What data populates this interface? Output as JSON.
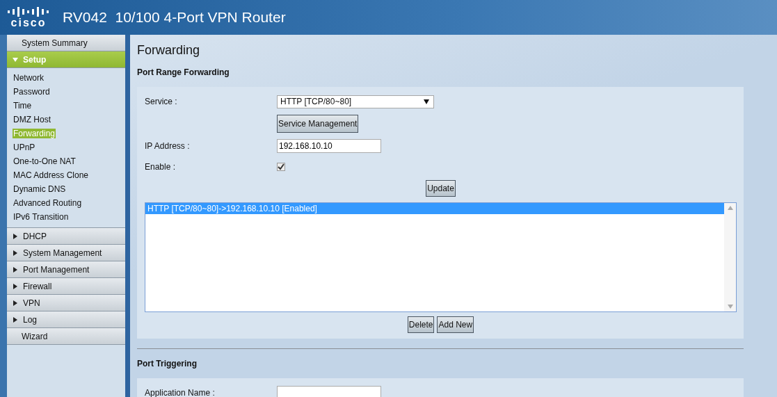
{
  "header": {
    "logo_text": "cisco",
    "title": "RV042  10/100 4-Port VPN Router"
  },
  "nav": [
    {
      "label": "System Summary",
      "kind": "plain"
    },
    {
      "label": "Setup",
      "kind": "section",
      "expanded": true,
      "children": [
        {
          "label": "Network",
          "selected": false
        },
        {
          "label": "Password",
          "selected": false
        },
        {
          "label": "Time",
          "selected": false
        },
        {
          "label": "DMZ Host",
          "selected": false
        },
        {
          "label": "Forwarding",
          "selected": true
        },
        {
          "label": "UPnP",
          "selected": false
        },
        {
          "label": "One-to-One NAT",
          "selected": false
        },
        {
          "label": "MAC Address Clone",
          "selected": false
        },
        {
          "label": "Dynamic DNS",
          "selected": false
        },
        {
          "label": "Advanced Routing",
          "selected": false
        },
        {
          "label": "IPv6 Transition",
          "selected": false
        }
      ]
    },
    {
      "label": "DHCP",
      "kind": "section",
      "expanded": false
    },
    {
      "label": "System Management",
      "kind": "section",
      "expanded": false
    },
    {
      "label": "Port Management",
      "kind": "section",
      "expanded": false
    },
    {
      "label": "Firewall",
      "kind": "section",
      "expanded": false
    },
    {
      "label": "VPN",
      "kind": "section",
      "expanded": false
    },
    {
      "label": "Log",
      "kind": "section",
      "expanded": false
    },
    {
      "label": "Wizard",
      "kind": "plain"
    }
  ],
  "page_title": "Forwarding",
  "port_range": {
    "heading": "Port Range Forwarding",
    "service_label": "Service :",
    "service_value": "HTTP [TCP/80~80]",
    "service_button": "Service Management",
    "ip_label": "IP Address :",
    "ip_value": "192.168.10.10",
    "enable_label": "Enable :",
    "enable_checked": true,
    "update_button": "Update",
    "entries": [
      {
        "text": "HTTP [TCP/80~80]->192.168.10.10 [Enabled]",
        "selected": true
      }
    ],
    "buttons": [
      "Delete",
      "Add New"
    ]
  },
  "port_triggering": {
    "heading": "Port Triggering",
    "app_label": "Application Name :"
  }
}
